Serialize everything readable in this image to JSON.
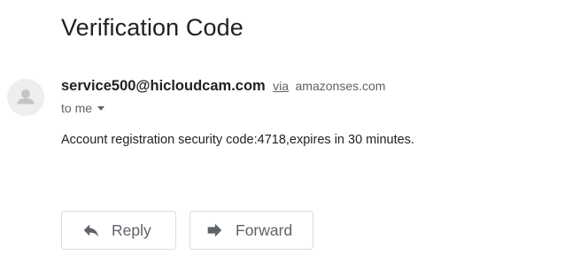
{
  "email": {
    "subject": "Verification Code",
    "sender": {
      "email": "service500@hicloudcam.com",
      "via_label": "via",
      "via_domain": "amazonses.com"
    },
    "recipient_label": "to me",
    "body": "Account registration security code:4718,expires in 30 minutes."
  },
  "actions": {
    "reply_label": "Reply",
    "forward_label": "Forward"
  }
}
